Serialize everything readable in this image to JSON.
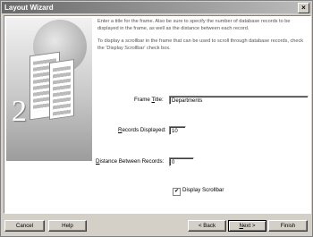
{
  "window": {
    "title": "Layout Wizard",
    "close_glyph": "×"
  },
  "step_number": "2",
  "instructions": {
    "p1": "Enter a title for the frame. Also be sure to specify the number of database records to be displayed in the frame, as well as the distance between each record.",
    "p2": "To display a scrollbar in the frame that can be used to scroll through database records, check the 'Display Scrollbar' check box."
  },
  "form": {
    "frame_title": {
      "label_pre": "Frame ",
      "label_ul": "T",
      "label_post": "itle:",
      "value": "Departments"
    },
    "records_displayed": {
      "label_ul": "R",
      "label_post": "ecords Displayed:",
      "value": "10"
    },
    "distance": {
      "label_ul": "D",
      "label_post": "istance Between Records:",
      "value": "0"
    },
    "display_scrollbar": {
      "label": "Display Scrollbar",
      "checked": true,
      "check_glyph": "✔"
    }
  },
  "buttons": {
    "cancel": "Cancel",
    "help": "Help",
    "back": "< Back",
    "next_ul": "N",
    "next_post": "ext >",
    "finish": "Finish"
  },
  "icons": [
    "close-icon",
    "wizard-illustration",
    "checkbox-check-icon"
  ]
}
